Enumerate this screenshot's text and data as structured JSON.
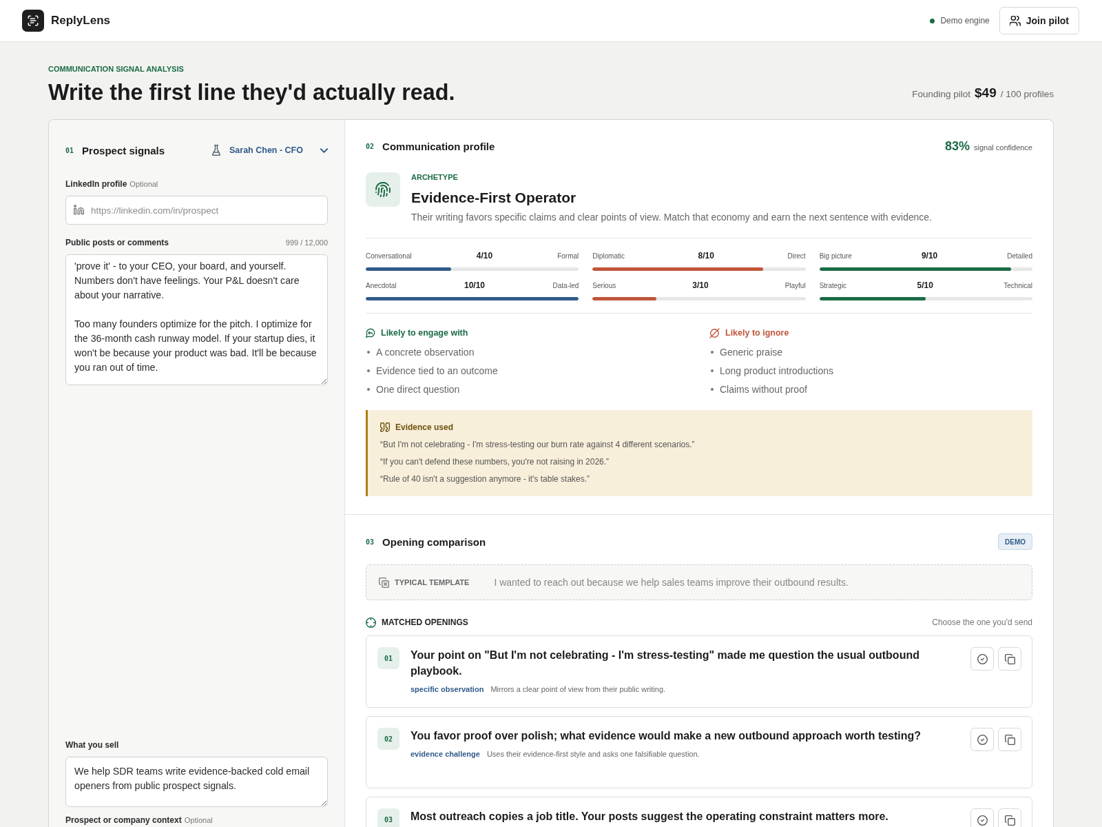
{
  "header": {
    "brand": "ReplyLens",
    "engine_status": "Demo engine",
    "join_button": "Join pilot"
  },
  "hero": {
    "eyebrow": "COMMUNICATION SIGNAL ANALYSIS",
    "title": "Write the first line they'd actually read.",
    "pricing": {
      "prefix": "Founding pilot",
      "price": "$49",
      "suffix": "/ 100 profiles"
    }
  },
  "prospect_panel": {
    "step": "01",
    "title": "Prospect signals",
    "sample_select": "Sarah Chen - CFO",
    "linkedin": {
      "label": "LinkedIn profile",
      "hint": "Optional",
      "placeholder": "https://linkedin.com/in/prospect"
    },
    "posts": {
      "label": "Public posts or comments",
      "counter": "999 / 12,000",
      "value": "'prove it' - to your CEO, your board, and yourself. Numbers don't have feelings. Your P&L doesn't care about your narrative.\n\nToo many founders optimize for the pitch. I optimize for the 36-month cash runway model. If your startup dies, it won't be because your product was bad. It'll be because you ran out of time."
    },
    "what_you_sell": {
      "label": "What you sell",
      "value": "We help SDR teams write evidence-backed cold email openers from public prospect signals."
    },
    "context": {
      "label": "Prospect or company context",
      "hint": "Optional"
    }
  },
  "profile": {
    "step": "02",
    "title": "Communication profile",
    "confidence": "83%",
    "confidence_label": "signal confidence",
    "archetype_label": "ARCHETYPE",
    "archetype": "Evidence-First Operator",
    "summary": "Their writing favors specific claims and clear points of view. Match that economy and earn the next sentence with evidence.",
    "scales": [
      {
        "left": "Conversational",
        "score": "4/10",
        "right": "Formal",
        "level": 0.4,
        "color": "#2f5b8a"
      },
      {
        "left": "Diplomatic",
        "score": "8/10",
        "right": "Direct",
        "level": 0.8,
        "color": "#c0563b"
      },
      {
        "left": "Big picture",
        "score": "9/10",
        "right": "Detailed",
        "level": 0.9,
        "color": "#1b6b45"
      },
      {
        "left": "Anecdotal",
        "score": "10/10",
        "right": "Data-led",
        "level": 1.0,
        "color": "#2f5b8a"
      },
      {
        "left": "Serious",
        "score": "3/10",
        "right": "Playful",
        "level": 0.3,
        "color": "#c0563b"
      },
      {
        "left": "Strategic",
        "score": "5/10",
        "right": "Technical",
        "level": 0.5,
        "color": "#1b6b45"
      }
    ],
    "engage": {
      "title": "Likely to engage with",
      "items": [
        "A concrete observation",
        "Evidence tied to an outcome",
        "One direct question"
      ]
    },
    "ignore": {
      "title": "Likely to ignore",
      "items": [
        "Generic praise",
        "Long product introductions",
        "Claims without proof"
      ]
    },
    "evidence": {
      "title": "Evidence used",
      "quotes": [
        "“But I'm not celebrating - I'm stress-testing our burn rate against 4 different scenarios.”",
        "“If you can't defend these numbers, you're not raising in 2026.”",
        "“Rule of 40 isn't a suggestion anymore - it's table stakes.”"
      ]
    }
  },
  "openings": {
    "step": "03",
    "title": "Opening comparison",
    "badge": "DEMO",
    "template": {
      "label": "TYPICAL TEMPLATE",
      "text": "I wanted to reach out because we help sales teams improve their outbound results."
    },
    "matched_label": "MATCHED OPENINGS",
    "matched_hint": "Choose the one you'd send",
    "items": [
      {
        "number": "01",
        "text": "Your point on \"But I'm not celebrating - I'm stress-testing\" made me question the usual outbound playbook.",
        "tag": "specific observation",
        "note": "Mirrors a clear point of view from their public writing."
      },
      {
        "number": "02",
        "text": "You favor proof over polish; what evidence would make a new outbound approach worth testing?",
        "tag": "evidence challenge",
        "note": "Uses their evidence-first style and asks one falsifiable question."
      },
      {
        "number": "03",
        "text": "Most outreach copies a job title. Your posts suggest the operating constraint matters more."
      }
    ]
  }
}
